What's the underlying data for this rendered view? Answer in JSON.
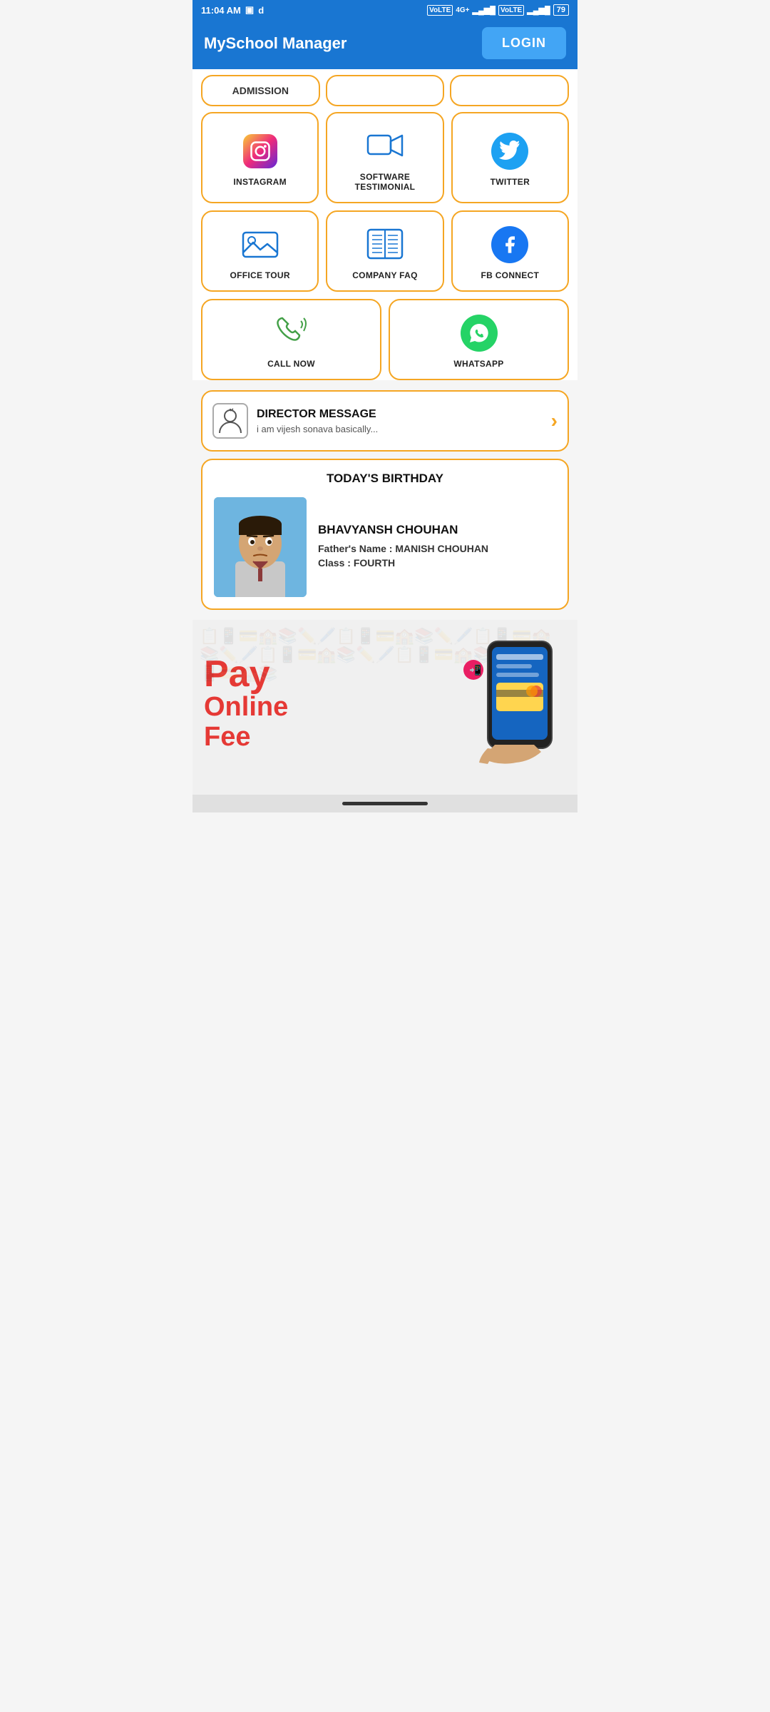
{
  "statusBar": {
    "time": "11:04 AM",
    "battery": "79"
  },
  "header": {
    "title": "MySchool Manager",
    "loginLabel": "LOGIN"
  },
  "grid": {
    "admissionLabel": "ADMISSION",
    "items": [
      {
        "id": "instagram",
        "label": "INSTAGRAM",
        "icon": "instagram-icon"
      },
      {
        "id": "software-testimonial",
        "label": "SOFTWARE TESTIMONIAL",
        "icon": "video-camera-icon"
      },
      {
        "id": "twitter",
        "label": "TWITTER",
        "icon": "twitter-icon"
      },
      {
        "id": "office-tour",
        "label": "OFFICE TOUR",
        "icon": "image-icon"
      },
      {
        "id": "company-faq",
        "label": "COMPANY FAQ",
        "icon": "book-icon"
      },
      {
        "id": "fb-connect",
        "label": "FB CONNECT",
        "icon": "facebook-icon"
      },
      {
        "id": "call-now",
        "label": "CALL NOW",
        "icon": "phone-icon"
      },
      {
        "id": "whatsapp",
        "label": "WHATSAPP",
        "icon": "whatsapp-icon"
      }
    ]
  },
  "directorMessage": {
    "title": "DIRECTOR MESSAGE",
    "subtitle": "i am vijesh sonava basically...",
    "iconLabel": "director-profile-icon"
  },
  "birthday": {
    "sectionTitle": "TODAY'S BIRTHDAY",
    "name": "BHAVYANSH CHOUHAN",
    "fatherLabel": "Father's Name :",
    "fatherName": "MANISH CHOUHAN",
    "classLabel": "Class :",
    "className": "FOURTH"
  },
  "payBanner": {
    "line1": "Pay",
    "line2": "Online",
    "line3": "Fee"
  }
}
